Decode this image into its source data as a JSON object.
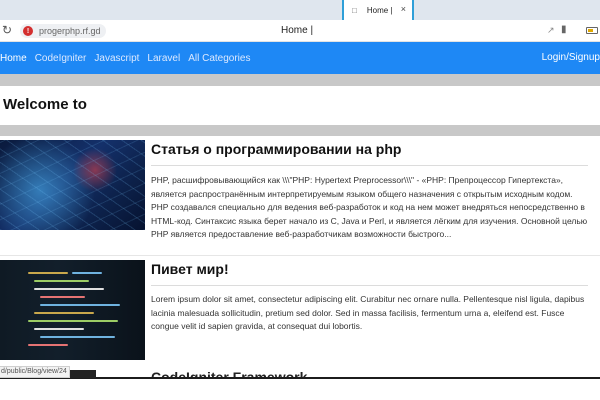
{
  "browser": {
    "tab_title": "Home |",
    "tab_close": "×",
    "url": "progerphp.rf.gd",
    "page_title": "Home |",
    "status_url": "d/public/Blog/view/24"
  },
  "navbar": {
    "links": [
      "Home",
      "CodeIgniter",
      "Javascript",
      "Laravel",
      "All Categories"
    ],
    "right": "Login/Signup"
  },
  "page": {
    "welcome": "Welcome to"
  },
  "articles": [
    {
      "title": "Статья о программировании на php",
      "body": "PHP, расшифровывающийся как \\\\\\\"PHP: Hypertext Preprocessor\\\\\\\" - «PHP: Препроцессор Гипертекста», является распространённым интерпретируемым языком общего назначения с открытым исходным кодом. PHP создавался специально для ведения веб-разработок и код на нем может внедряться непосредственно в HTML-код. Синтаксис языка берет начало из C, Java и Perl, и является лёгким для изучения. Основной целью PHP является предоставление веб-разработчикам возможности быстрого..."
    },
    {
      "title": "Пивет мир!",
      "body": "Lorem ipsum dolor sit amet, consectetur adipiscing elit. Curabitur nec ornare nulla. Pellentesque nisl ligula, dapibus lacinia malesuada sollicitudin, pretium sed dolor. Sed in massa facilisis, fermentum urna a, eleifend est. Fusce congue velit id sapien gravida, at consequat dui lobortis."
    },
    {
      "title": "CodeIgniter Framework"
    }
  ]
}
